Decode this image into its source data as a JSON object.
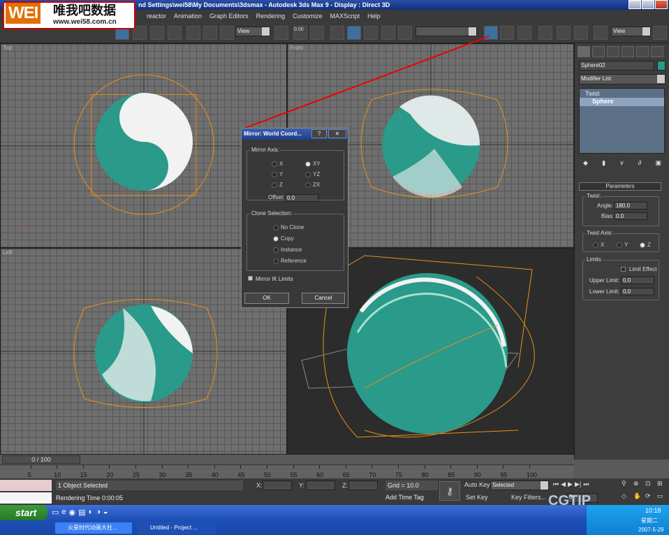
{
  "window": {
    "title": "nd Settings\\wei58\\My Documents\\3dsmax     - Autodesk 3ds Max 9      - Display : Direct 3D"
  },
  "menu": [
    "reactor",
    "Animation",
    "Graph Editors",
    "Rendering",
    "Customize",
    "MAXScript",
    "Help"
  ],
  "logo": {
    "main": "WEI",
    "cn": "唯我吧数据",
    "url": "www.wei58.com.cn"
  },
  "toolbar": {
    "view1": "View",
    "view2": "View",
    "snap_pct": "0.00"
  },
  "viewports": {
    "top": "Top",
    "front": "Front",
    "left": "Left"
  },
  "dialog": {
    "title": "Mirror: World Coord...",
    "mirror_axis": "Mirror Axis:",
    "axes": [
      "X",
      "Y",
      "Z",
      "XY",
      "YZ",
      "ZX"
    ],
    "selected_axis": "XY",
    "offset_label": "Offset:",
    "offset_value": "0.0",
    "clone_selection": "Clone Selection:",
    "clones": [
      "No Clone",
      "Copy",
      "Instance",
      "Reference"
    ],
    "selected_clone": "Copy",
    "mirror_ik": "Mirror IK Limits",
    "ok": "OK",
    "cancel": "Cancel"
  },
  "command_panel": {
    "object_name": "Sphere02",
    "modifier_list": "Modifier List",
    "stack": [
      "Twist",
      "Sphere"
    ],
    "parameters": "Parameters",
    "twist": "Twist:",
    "angle_label": "Angle:",
    "angle_value": "180.0",
    "bias_label": "Bias:",
    "bias_value": "0.0",
    "twist_axis": "Twist Axis:",
    "axes": [
      "X",
      "Y",
      "Z"
    ],
    "selected_axis": "Z",
    "limits": "Limits",
    "limit_effect": "Limit Effect",
    "upper_label": "Upper Limit:",
    "upper_value": "0.0",
    "lower_label": "Lower Limit:",
    "lower_value": "0.0"
  },
  "timeline": {
    "frame": "0 / 100",
    "ticks": [
      "5",
      "10",
      "15",
      "20",
      "25",
      "30",
      "35",
      "40",
      "45",
      "50",
      "55",
      "60",
      "65",
      "70",
      "75",
      "80",
      "85",
      "90",
      "95",
      "100"
    ]
  },
  "status": {
    "selected": "1 Object Selected",
    "render_time": "Rendering Time  0:00:05",
    "x": "X:",
    "y": "Y:",
    "z": "Z:",
    "grid": "Grid = 10.0",
    "add_time_tag": "Add Time Tag",
    "auto_key": "Auto Key",
    "selected_dd": "Selected",
    "set_key": "Set Key",
    "key_filters": "Key Filters...",
    "frame_field": "0"
  },
  "taskbar": {
    "start": "start",
    "tasks": [
      "火星时代动画大社...",
      "Untitled     - Project ..."
    ],
    "clock": "10:18",
    "date": "2007-5-29",
    "ime": "星期二"
  },
  "watermark": "CGTIP"
}
